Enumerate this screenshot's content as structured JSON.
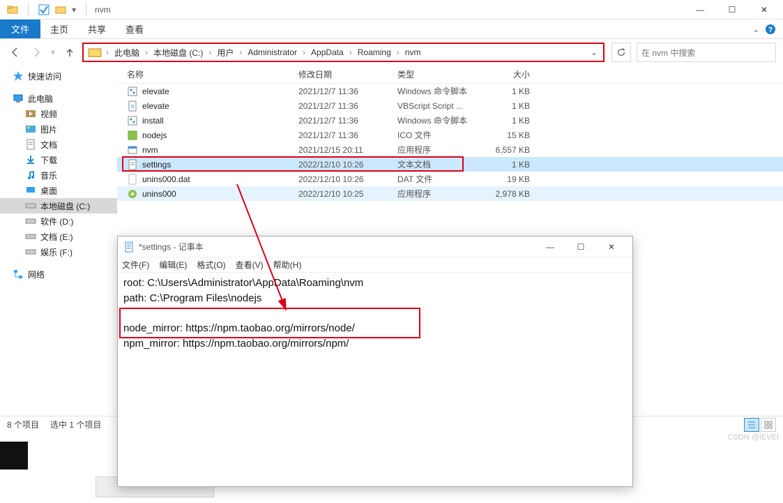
{
  "window": {
    "title": "nvm",
    "controls": {
      "min": "—",
      "max": "☐",
      "close": "✕"
    }
  },
  "ribbon": {
    "file": "文件",
    "tabs": [
      "主页",
      "共享",
      "查看"
    ]
  },
  "breadcrumb": {
    "segments": [
      "此电脑",
      "本地磁盘 (C:)",
      "用户",
      "Administrator",
      "AppData",
      "Roaming",
      "nvm"
    ]
  },
  "search": {
    "placeholder": "在 nvm 中搜索"
  },
  "sidebar": {
    "quick": {
      "label": "快速访问"
    },
    "thispc": {
      "label": "此电脑",
      "children": [
        "视频",
        "图片",
        "文档",
        "下载",
        "音乐",
        "桌面",
        "本地磁盘 (C:)",
        "软件 (D:)",
        "文档 (E:)",
        "娱乐 (F:)"
      ]
    },
    "network": {
      "label": "网络"
    }
  },
  "columns": {
    "name": "名称",
    "date": "修改日期",
    "type": "类型",
    "size": "大小"
  },
  "files": [
    {
      "name": "elevate",
      "date": "2021/12/7 11:36",
      "type": "Windows 命令脚本",
      "size": "1 KB",
      "icon": "cmd"
    },
    {
      "name": "elevate",
      "date": "2021/12/7 11:36",
      "type": "VBScript Script ...",
      "size": "1 KB",
      "icon": "vbs"
    },
    {
      "name": "install",
      "date": "2021/12/7 11:36",
      "type": "Windows 命令脚本",
      "size": "1 KB",
      "icon": "cmd"
    },
    {
      "name": "nodejs",
      "date": "2021/12/7 11:36",
      "type": "ICO 文件",
      "size": "15 KB",
      "icon": "ico"
    },
    {
      "name": "nvm",
      "date": "2021/12/15 20:11",
      "type": "应用程序",
      "size": "6,557 KB",
      "icon": "exe"
    },
    {
      "name": "settings",
      "date": "2022/12/10 10:26",
      "type": "文本文档",
      "size": "1 KB",
      "icon": "txt",
      "selected": true
    },
    {
      "name": "unins000.dat",
      "date": "2022/12/10 10:26",
      "type": "DAT 文件",
      "size": "19 KB",
      "icon": "dat"
    },
    {
      "name": "unins000",
      "date": "2022/12/10 10:25",
      "type": "应用程序",
      "size": "2,978 KB",
      "icon": "exe2",
      "hover": true
    }
  ],
  "status": {
    "count": "8 个项目",
    "selected": "选中 1 个项目"
  },
  "notepad": {
    "title": "*settings - 记事本",
    "menu": [
      "文件(F)",
      "编辑(E)",
      "格式(O)",
      "查看(V)",
      "帮助(H)"
    ],
    "lines": [
      "root: C:\\Users\\Administrator\\AppData\\Roaming\\nvm",
      "path: C:\\Program Files\\nodejs",
      "",
      "node_mirror: https://npm.taobao.org/mirrors/node/",
      "npm_mirror: https://npm.taobao.org/mirrors/npm/"
    ]
  },
  "watermark": "CSDN @IEVEI"
}
